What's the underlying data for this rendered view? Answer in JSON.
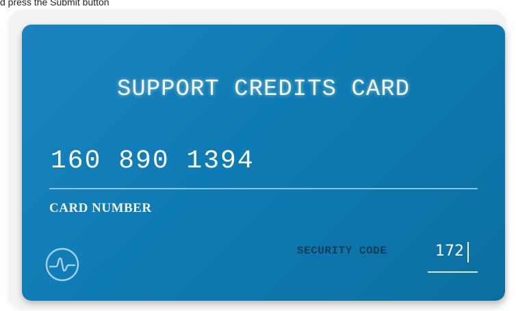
{
  "instruction": {
    "text": "d press the Submit button"
  },
  "card": {
    "title": "SUPPORT CREDITS CARD",
    "number": "160 890 1394",
    "number_label": "CARD NUMBER",
    "logo_icon": "waveform-circle-icon",
    "security_code_label": "SECURITY CODE",
    "security_code_value": "172",
    "colors": {
      "card_bg": "#0e7cb4",
      "title_text": "#f4f8fb",
      "label_dark": "#0c3d57"
    }
  }
}
